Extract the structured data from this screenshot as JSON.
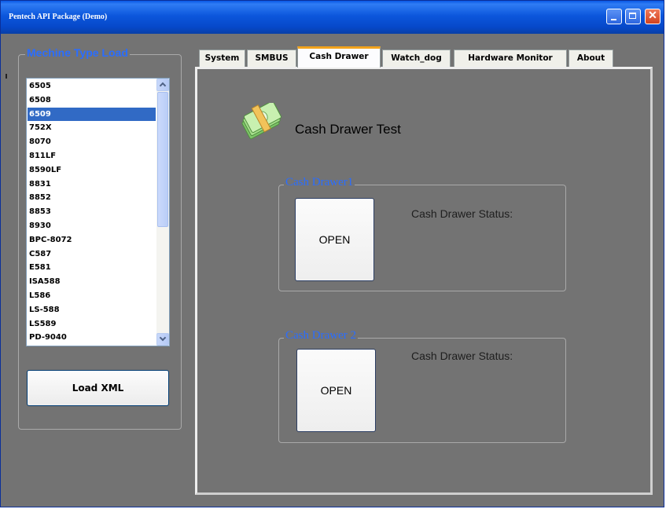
{
  "window": {
    "title": "Pentech API Package (Demo)",
    "controls": {
      "minimize": "minimize-icon",
      "maximize": "maximize-icon",
      "close": "close-icon"
    }
  },
  "machine_type": {
    "legend": "Mechine Type Load",
    "items": [
      "6505",
      "6508",
      "6509",
      "752X",
      "8070",
      "811LF",
      "8590LF",
      "8831",
      "8852",
      "8853",
      "8930",
      "BPC-8072",
      "C587",
      "E581",
      "ISA588",
      "L586",
      "LS-588",
      "LS589",
      "PD-9040"
    ],
    "selected": "6509",
    "load_button": "Load XML"
  },
  "tabs": [
    "System",
    "SMBUS",
    "Cash Drawer",
    "Watch_dog",
    "Hardware Monitor",
    "About"
  ],
  "active_tab": "Cash Drawer",
  "cash_drawer": {
    "title": "Cash Drawer Test",
    "icon": "money-icon",
    "drawers": [
      {
        "legend": "Cash Drawer1",
        "button": "OPEN",
        "status_label": "Cash Drawer Status:"
      },
      {
        "legend": "Cash Drawer 2",
        "button": "OPEN",
        "status_label": "Cash Drawer Status:"
      }
    ]
  },
  "colors": {
    "accent": "#2a6dff",
    "titlebar": "#0c57dc",
    "selection": "#316ac5",
    "active_tab_marker": "#f2a31c",
    "background": "#737373"
  }
}
